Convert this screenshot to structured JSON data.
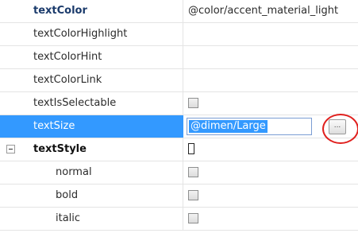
{
  "properties": [
    {
      "name": "textColor",
      "value": "@color/accent_material_light",
      "type": "text",
      "bold": true
    },
    {
      "name": "textColorHighlight",
      "value": "",
      "type": "text"
    },
    {
      "name": "textColorHint",
      "value": "",
      "type": "text"
    },
    {
      "name": "textColorLink",
      "value": "",
      "type": "text"
    },
    {
      "name": "textIsSelectable",
      "value": "",
      "type": "checkbox"
    },
    {
      "name": "textSize",
      "value": "@dimen/Large",
      "type": "editor",
      "selected": true,
      "button_label": "..."
    },
    {
      "name": "textStyle",
      "value": "",
      "type": "category"
    },
    {
      "name": "normal",
      "value": "",
      "type": "checkbox",
      "child": true
    },
    {
      "name": "bold",
      "value": "",
      "type": "checkbox",
      "child": true
    },
    {
      "name": "italic",
      "value": "",
      "type": "checkbox",
      "child": true
    }
  ],
  "colors": {
    "selection": "#3399ff",
    "highlight_circle": "#e0201e",
    "bold_name": "#1a3a6b"
  }
}
